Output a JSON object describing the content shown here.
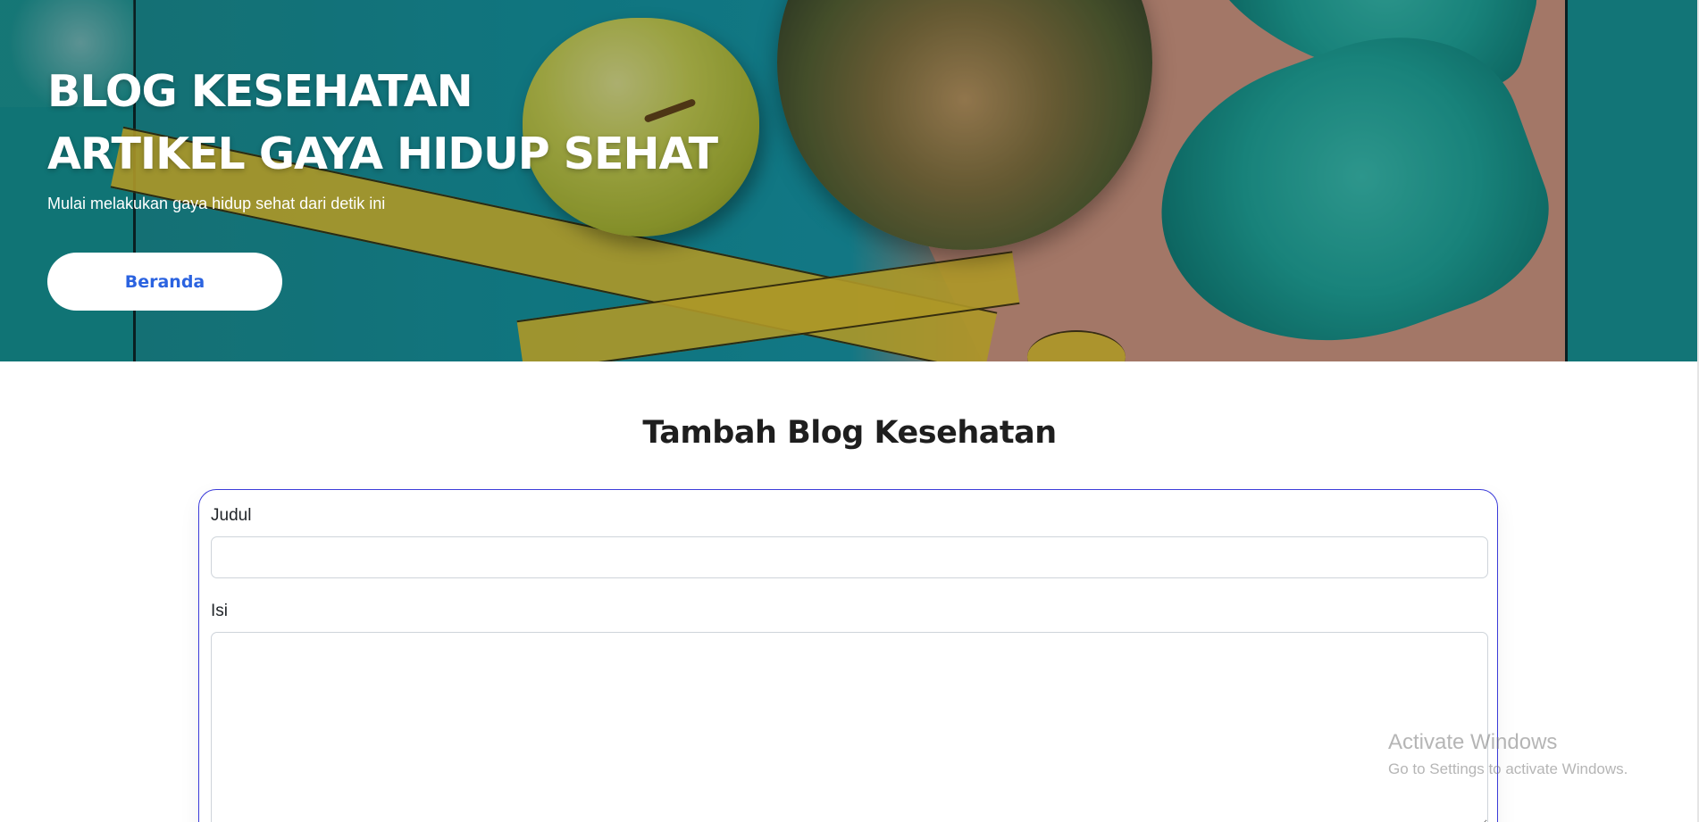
{
  "hero": {
    "title_line1": "BLOG KESEHATAN",
    "title_line2": "ARTIKEL GAYA HIDUP SEHAT",
    "subtitle": "Mulai melakukan gaya hidup sehat dari detik ini",
    "button_label": "Beranda"
  },
  "main": {
    "page_title": "Tambah Blog Kesehatan",
    "form": {
      "title_label": "Judul",
      "title_value": "",
      "content_label": "Isi",
      "content_value": ""
    }
  },
  "watermark": {
    "title": "Activate Windows",
    "subtitle": "Go to Settings to activate Windows."
  },
  "colors": {
    "accent": "#2b63e0",
    "card_border": "#3b3bd9",
    "hero_primary": "#16a3b2",
    "hero_secondary": "#e2a58f"
  }
}
